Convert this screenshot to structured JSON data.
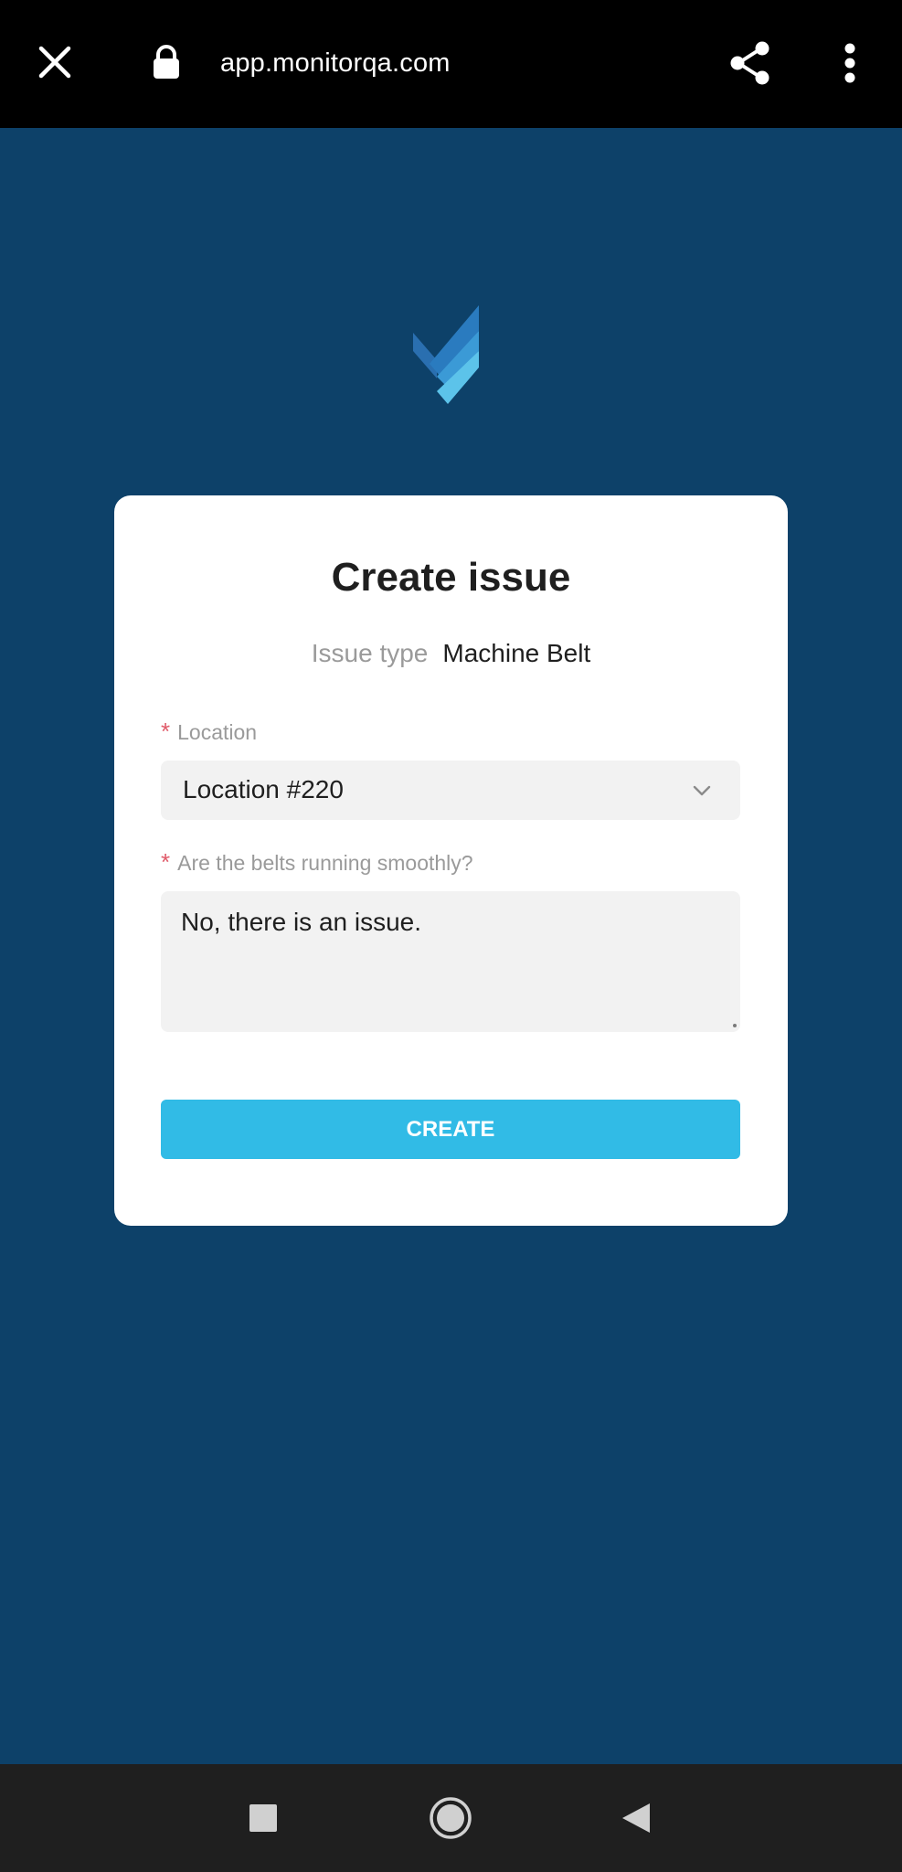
{
  "browser": {
    "url": "app.monitorqa.com",
    "icons": {
      "close": "close-icon",
      "lock": "lock-icon",
      "share": "share-icon",
      "menu": "more-vertical-icon"
    }
  },
  "logo": {
    "icon": "monitorqa-logo",
    "colors": [
      "#2a7bbf",
      "#3b9ad6",
      "#5cc3ea"
    ]
  },
  "card": {
    "title": "Create issue",
    "issue_type_label": "Issue type",
    "issue_type_value": "Machine Belt",
    "location": {
      "required_mark": "*",
      "label": "Location",
      "value": "Location #220",
      "icon": "chevron-down-icon"
    },
    "belts_question": {
      "required_mark": "*",
      "label": "Are the belts running smoothly?",
      "value": "No, there is an issue."
    },
    "create_button": "CREATE"
  },
  "navbar": {
    "icons": [
      "recents-square-icon",
      "home-circle-icon",
      "back-triangle-icon"
    ]
  },
  "colors": {
    "background": "#0d4169",
    "accent": "#31bbe6",
    "required": "#e05b6a"
  }
}
